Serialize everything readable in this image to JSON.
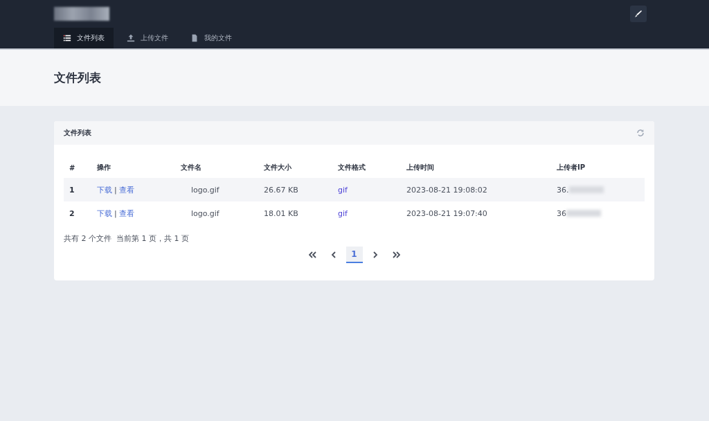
{
  "header": {
    "tabs": [
      {
        "label": "文件列表",
        "selected": true
      },
      {
        "label": "上传文件",
        "selected": false
      },
      {
        "label": "我的文件",
        "selected": false
      }
    ]
  },
  "page_title": "文件列表",
  "card": {
    "title": "文件列表",
    "table": {
      "columns": [
        "#",
        "操作",
        "文件名",
        "文件大小",
        "文件格式",
        "上传时间",
        "上传者IP"
      ],
      "rows": [
        {
          "index": "1",
          "download": "下载",
          "separator": "|",
          "view": "查看",
          "name": "logo.gif",
          "size": "26.67 KB",
          "format": "gif",
          "time": "2023-08-21 19:08:02",
          "ip": "36."
        },
        {
          "index": "2",
          "download": "下载",
          "separator": "|",
          "view": "查看",
          "name": "logo.gif",
          "size": "18.01 KB",
          "format": "gif",
          "time": "2023-08-21 19:07:40",
          "ip": "36"
        }
      ]
    },
    "summary": "共有 2 个文件  当前第 1 页，共 1 页",
    "pagination": {
      "pages": [
        {
          "label": "1",
          "selected": true
        }
      ]
    }
  }
}
